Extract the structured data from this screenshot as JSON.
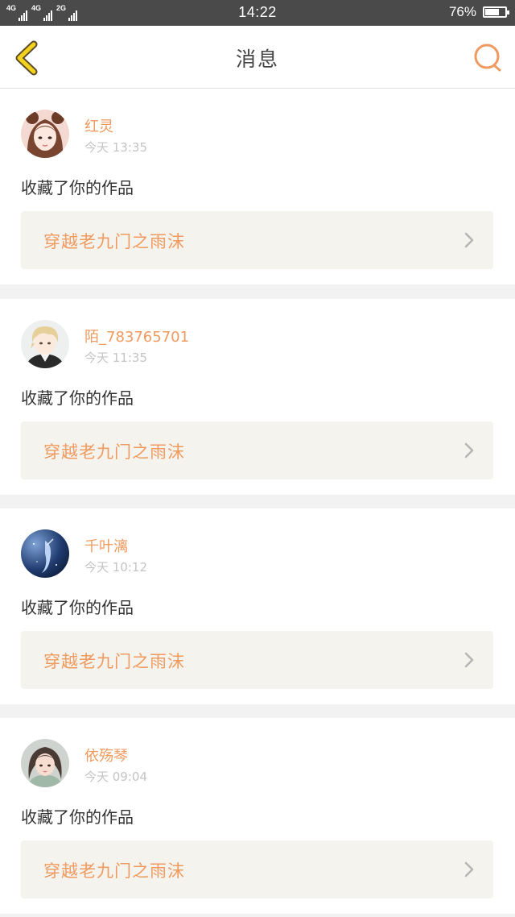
{
  "status_bar": {
    "network_1": "4G",
    "network_2": "4G",
    "network_3": "2G",
    "time": "14:22",
    "battery": "76%",
    "battery_level": 0.76
  },
  "header": {
    "title": "消息",
    "back_icon": "chevron-left-icon",
    "search_icon": "search-icon"
  },
  "colors": {
    "accent": "#ef9a5e",
    "back_arrow": "#f2d21c",
    "card_link_bg": "#f4f3ee",
    "page_bg": "#f2f2f2"
  },
  "messages": [
    {
      "user": "红灵",
      "time": "今天 13:35",
      "action": "收藏了你的作品",
      "work": "穿越老九门之雨沫"
    },
    {
      "user": "陌_783765701",
      "time": "今天 11:35",
      "action": "收藏了你的作品",
      "work": "穿越老九门之雨沫"
    },
    {
      "user": "千叶漓",
      "time": "今天 10:12",
      "action": "收藏了你的作品",
      "work": "穿越老九门之雨沫"
    },
    {
      "user": "依殇琴",
      "time": "今天 09:04",
      "action": "收藏了你的作品",
      "work": "穿越老九门之雨沫"
    }
  ]
}
